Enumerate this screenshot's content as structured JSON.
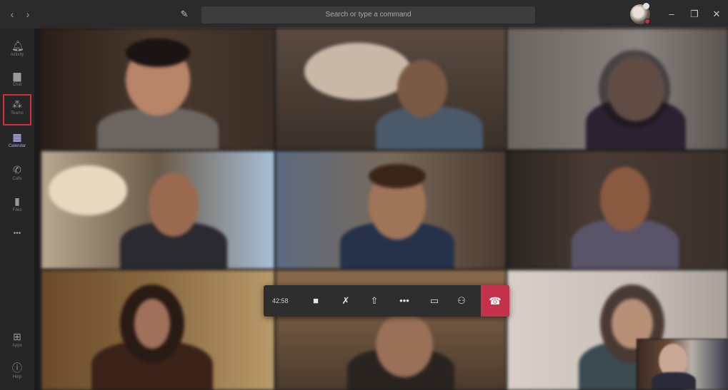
{
  "titlebar": {
    "back_icon": "chevron-left-icon",
    "forward_icon": "chevron-right-icon",
    "compose_icon": "compose-icon",
    "search_placeholder": "Search or type a command",
    "minimize_icon": "minimize-icon",
    "restore_icon": "restore-icon",
    "close_icon": "close-icon"
  },
  "rail": {
    "items": [
      {
        "label": "Activity",
        "icon": "bell-icon"
      },
      {
        "label": "Chat",
        "icon": "chat-icon"
      },
      {
        "label": "Teams",
        "icon": "teams-icon"
      },
      {
        "label": "Calendar",
        "icon": "calendar-icon"
      },
      {
        "label": "Calls",
        "icon": "phone-icon"
      },
      {
        "label": "Files",
        "icon": "file-icon"
      },
      {
        "label": "•••",
        "icon": "more-icon"
      },
      {
        "label": "Apps",
        "icon": "apps-icon"
      },
      {
        "label": "Help",
        "icon": "help-icon"
      }
    ]
  },
  "callbar": {
    "timer": "42:58",
    "hangup_icon": "phone-hangup-icon"
  },
  "colors": {
    "accent": "#6264a7",
    "hangup": "#c4314b",
    "highlight_box": "#d92c3a"
  }
}
